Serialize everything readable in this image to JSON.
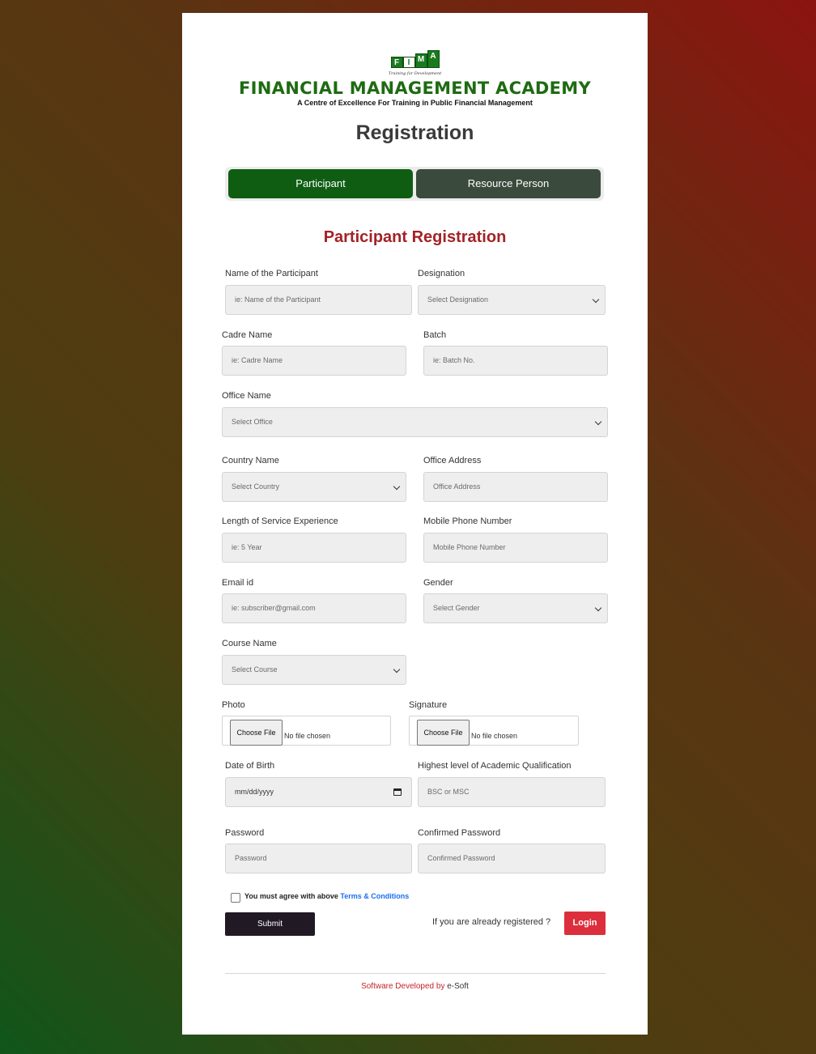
{
  "header": {
    "logo_letters": [
      "F",
      "I",
      "M",
      "A"
    ],
    "logo_tagline": "Training for Development",
    "academy_name": "FINANCIAL MANAGEMENT ACADEMY",
    "academy_subtitle": "A Centre of Excellence For Training in Public Financial Management",
    "brand_color": "#1e6b12"
  },
  "page_title": "Registration",
  "tabs": [
    {
      "label": "Participant",
      "active": true
    },
    {
      "label": "Resource Person",
      "active": false
    }
  ],
  "section_title": "Participant Registration",
  "form": {
    "participant_name": {
      "label": "Name of the Participant",
      "placeholder": "ie: Name of the Participant"
    },
    "designation": {
      "label": "Designation",
      "selected": "Select Designation"
    },
    "cadre_name": {
      "label": "Cadre Name",
      "placeholder": "ie: Cadre Name"
    },
    "batch": {
      "label": "Batch",
      "placeholder": "ie: Batch No."
    },
    "office_name": {
      "label": "Office Name",
      "selected": "Select Office"
    },
    "country_name": {
      "label": "Country Name",
      "selected": "Select Country"
    },
    "office_address": {
      "label": "Office Address",
      "placeholder": "Office Address"
    },
    "service_length": {
      "label": "Length of Service Experience",
      "placeholder": "ie: 5 Year"
    },
    "mobile": {
      "label": "Mobile Phone Number",
      "placeholder": "Mobile Phone Number"
    },
    "email": {
      "label": "Email id",
      "placeholder": "ie: subscriber@gmail.com"
    },
    "gender": {
      "label": "Gender",
      "selected": "Select Gender"
    },
    "course": {
      "label": "Course Name",
      "selected": "Select Course"
    },
    "photo": {
      "label": "Photo",
      "button": "Choose File",
      "status": "No file chosen"
    },
    "signature": {
      "label": "Signature",
      "button": "Choose File",
      "status": "No file chosen"
    },
    "dob": {
      "label": "Date of Birth",
      "placeholder": "mm/dd/yyyy"
    },
    "qualification": {
      "label": "Highest level of Academic Qualification",
      "placeholder": "BSC or MSC"
    },
    "password": {
      "label": "Password",
      "placeholder": "Password"
    },
    "confirm_password": {
      "label": "Confirmed Password",
      "placeholder": "Confirmed Password"
    }
  },
  "terms": {
    "text": "You must agree with above",
    "link": "Terms & Conditions",
    "checked": false
  },
  "actions": {
    "submit_label": "Submit",
    "already_text": "If you are already registered ?",
    "login_label": "Login"
  },
  "footer": {
    "text": "Software Developed by",
    "brand": "e-Soft"
  },
  "colors": {
    "active_tab": "#0f5d12",
    "inactive_tab": "#3a4b3d",
    "section_title": "#a32227",
    "login_button": "#dc2e3c",
    "submit_button": "#211a24",
    "link": "#1a6ff0"
  }
}
